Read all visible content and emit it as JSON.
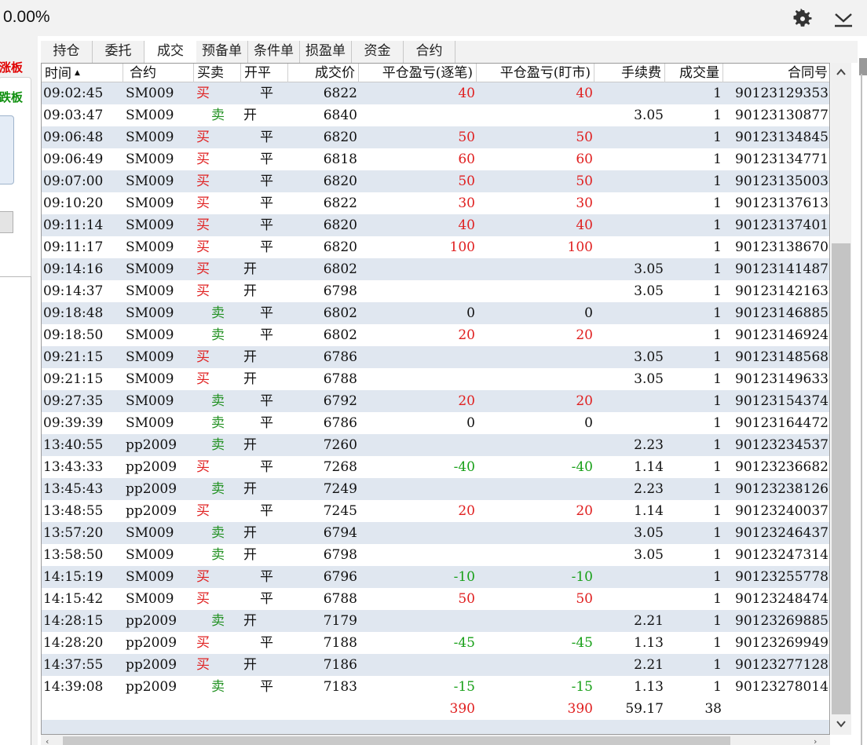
{
  "header": {
    "percent": "0.00%"
  },
  "left_panel": {
    "limit_up_label": "涨板",
    "limit_down_label": "跌板"
  },
  "tabs": [
    {
      "label": "持仓",
      "active": false
    },
    {
      "label": "委托",
      "active": false
    },
    {
      "label": "成交",
      "active": true
    },
    {
      "label": "预备单",
      "active": false
    },
    {
      "label": "条件单",
      "active": false
    },
    {
      "label": "损盈单",
      "active": false
    },
    {
      "label": "资金",
      "active": false
    },
    {
      "label": "合约",
      "active": false
    }
  ],
  "table": {
    "columns": [
      "时间",
      "合约",
      "买卖",
      "开平",
      "成交价",
      "平仓盈亏(逐笔)",
      "平仓盈亏(盯市)",
      "手续费",
      "成交量",
      "合同号"
    ],
    "sorted_column": "时间",
    "sort_direction": "ascending",
    "rows": [
      [
        "09:02:45",
        "SM009",
        "买",
        "平",
        "6822",
        "40",
        "40",
        "",
        "1",
        "90123129353"
      ],
      [
        "09:03:47",
        "SM009",
        "卖",
        "开",
        "6840",
        "",
        "",
        "3.05",
        "1",
        "90123130877"
      ],
      [
        "09:06:48",
        "SM009",
        "买",
        "平",
        "6820",
        "50",
        "50",
        "",
        "1",
        "90123134845"
      ],
      [
        "09:06:49",
        "SM009",
        "买",
        "平",
        "6818",
        "60",
        "60",
        "",
        "1",
        "90123134771"
      ],
      [
        "09:07:00",
        "SM009",
        "买",
        "平",
        "6820",
        "50",
        "50",
        "",
        "1",
        "90123135003"
      ],
      [
        "09:10:20",
        "SM009",
        "买",
        "平",
        "6822",
        "30",
        "30",
        "",
        "1",
        "90123137613"
      ],
      [
        "09:11:14",
        "SM009",
        "买",
        "平",
        "6820",
        "40",
        "40",
        "",
        "1",
        "90123137401"
      ],
      [
        "09:11:17",
        "SM009",
        "买",
        "平",
        "6820",
        "100",
        "100",
        "",
        "1",
        "90123138670"
      ],
      [
        "09:14:16",
        "SM009",
        "买",
        "开",
        "6802",
        "",
        "",
        "3.05",
        "1",
        "90123141487"
      ],
      [
        "09:14:37",
        "SM009",
        "买",
        "开",
        "6798",
        "",
        "",
        "3.05",
        "1",
        "90123142163"
      ],
      [
        "09:18:48",
        "SM009",
        "卖",
        "平",
        "6802",
        "0",
        "0",
        "",
        "1",
        "90123146885"
      ],
      [
        "09:18:50",
        "SM009",
        "卖",
        "平",
        "6802",
        "20",
        "20",
        "",
        "1",
        "90123146924"
      ],
      [
        "09:21:15",
        "SM009",
        "买",
        "开",
        "6786",
        "",
        "",
        "3.05",
        "1",
        "90123148568"
      ],
      [
        "09:21:15",
        "SM009",
        "买",
        "开",
        "6788",
        "",
        "",
        "3.05",
        "1",
        "90123149633"
      ],
      [
        "09:27:35",
        "SM009",
        "卖",
        "平",
        "6792",
        "20",
        "20",
        "",
        "1",
        "90123154374"
      ],
      [
        "09:39:39",
        "SM009",
        "卖",
        "平",
        "6786",
        "0",
        "0",
        "",
        "1",
        "90123164472"
      ],
      [
        "13:40:55",
        "pp2009",
        "卖",
        "开",
        "7260",
        "",
        "",
        "2.23",
        "1",
        "90123234537"
      ],
      [
        "13:43:33",
        "pp2009",
        "买",
        "平",
        "7268",
        "-40",
        "-40",
        "1.14",
        "1",
        "90123236682"
      ],
      [
        "13:45:43",
        "pp2009",
        "卖",
        "开",
        "7249",
        "",
        "",
        "2.23",
        "1",
        "90123238126"
      ],
      [
        "13:48:55",
        "pp2009",
        "买",
        "平",
        "7245",
        "20",
        "20",
        "1.14",
        "1",
        "90123240037"
      ],
      [
        "13:57:20",
        "SM009",
        "卖",
        "开",
        "6794",
        "",
        "",
        "3.05",
        "1",
        "90123246437"
      ],
      [
        "13:58:50",
        "SM009",
        "卖",
        "开",
        "6798",
        "",
        "",
        "3.05",
        "1",
        "90123247314"
      ],
      [
        "14:15:19",
        "SM009",
        "买",
        "平",
        "6796",
        "-10",
        "-10",
        "",
        "1",
        "90123255778"
      ],
      [
        "14:15:42",
        "SM009",
        "买",
        "平",
        "6788",
        "50",
        "50",
        "",
        "1",
        "90123248474"
      ],
      [
        "14:28:15",
        "pp2009",
        "卖",
        "开",
        "7179",
        "",
        "",
        "2.21",
        "1",
        "90123269885"
      ],
      [
        "14:28:20",
        "pp2009",
        "买",
        "平",
        "7188",
        "-45",
        "-45",
        "1.13",
        "1",
        "90123269949"
      ],
      [
        "14:37:55",
        "pp2009",
        "买",
        "开",
        "7186",
        "",
        "",
        "2.21",
        "1",
        "90123277128"
      ],
      [
        "14:39:08",
        "pp2009",
        "卖",
        "平",
        "7183",
        "-15",
        "-15",
        "1.13",
        "1",
        "90123278014"
      ]
    ],
    "totals": {
      "pnl_trade": "390",
      "pnl_mtm": "390",
      "fee": "59.17",
      "volume": "38"
    }
  },
  "icons": {
    "settings": "gear-icon",
    "collapse": "collapse-down-icon",
    "scroll_up": "chevron-up-icon",
    "scroll_down": "chevron-down-icon"
  },
  "colors": {
    "buy": "#e02020",
    "sell": "#209020",
    "profit": "#e02020",
    "loss": "#18a018"
  }
}
